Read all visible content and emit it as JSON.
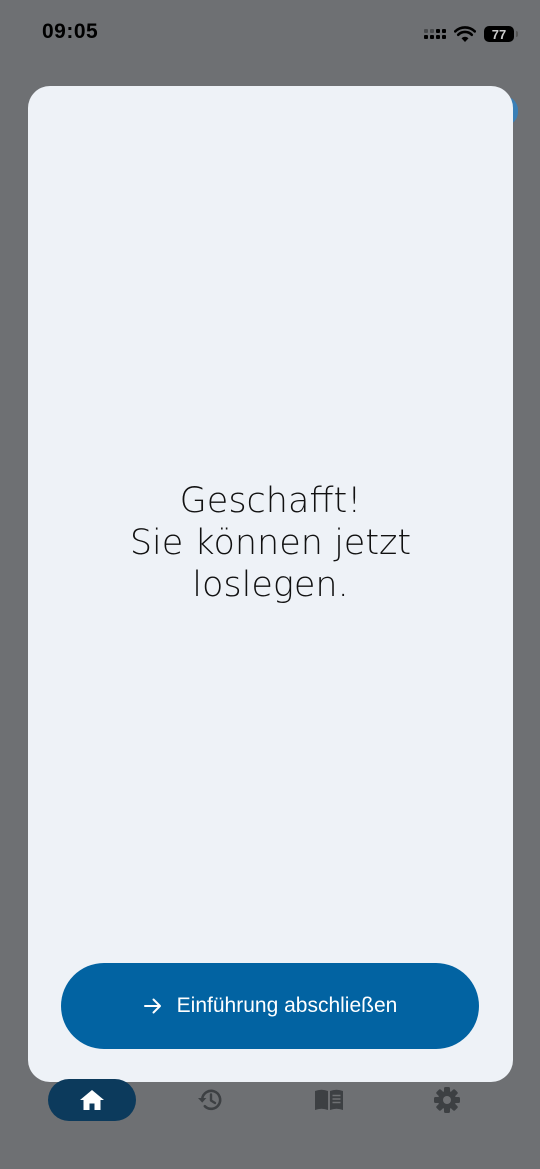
{
  "status_bar": {
    "time": "09:05",
    "battery_level": "77"
  },
  "dialog": {
    "message_lines": [
      "Geschafft!",
      "Sie können jetzt",
      "loslegen."
    ],
    "button_label": "Einführung abschließen",
    "button_icon": "arrow-right-icon",
    "button_color": "#0263a2"
  },
  "bottom_nav": {
    "items": [
      {
        "icon": "home-icon",
        "active": true
      },
      {
        "icon": "history-icon",
        "active": false
      },
      {
        "icon": "book-icon",
        "active": false
      },
      {
        "icon": "settings-icon",
        "active": false
      }
    ]
  }
}
